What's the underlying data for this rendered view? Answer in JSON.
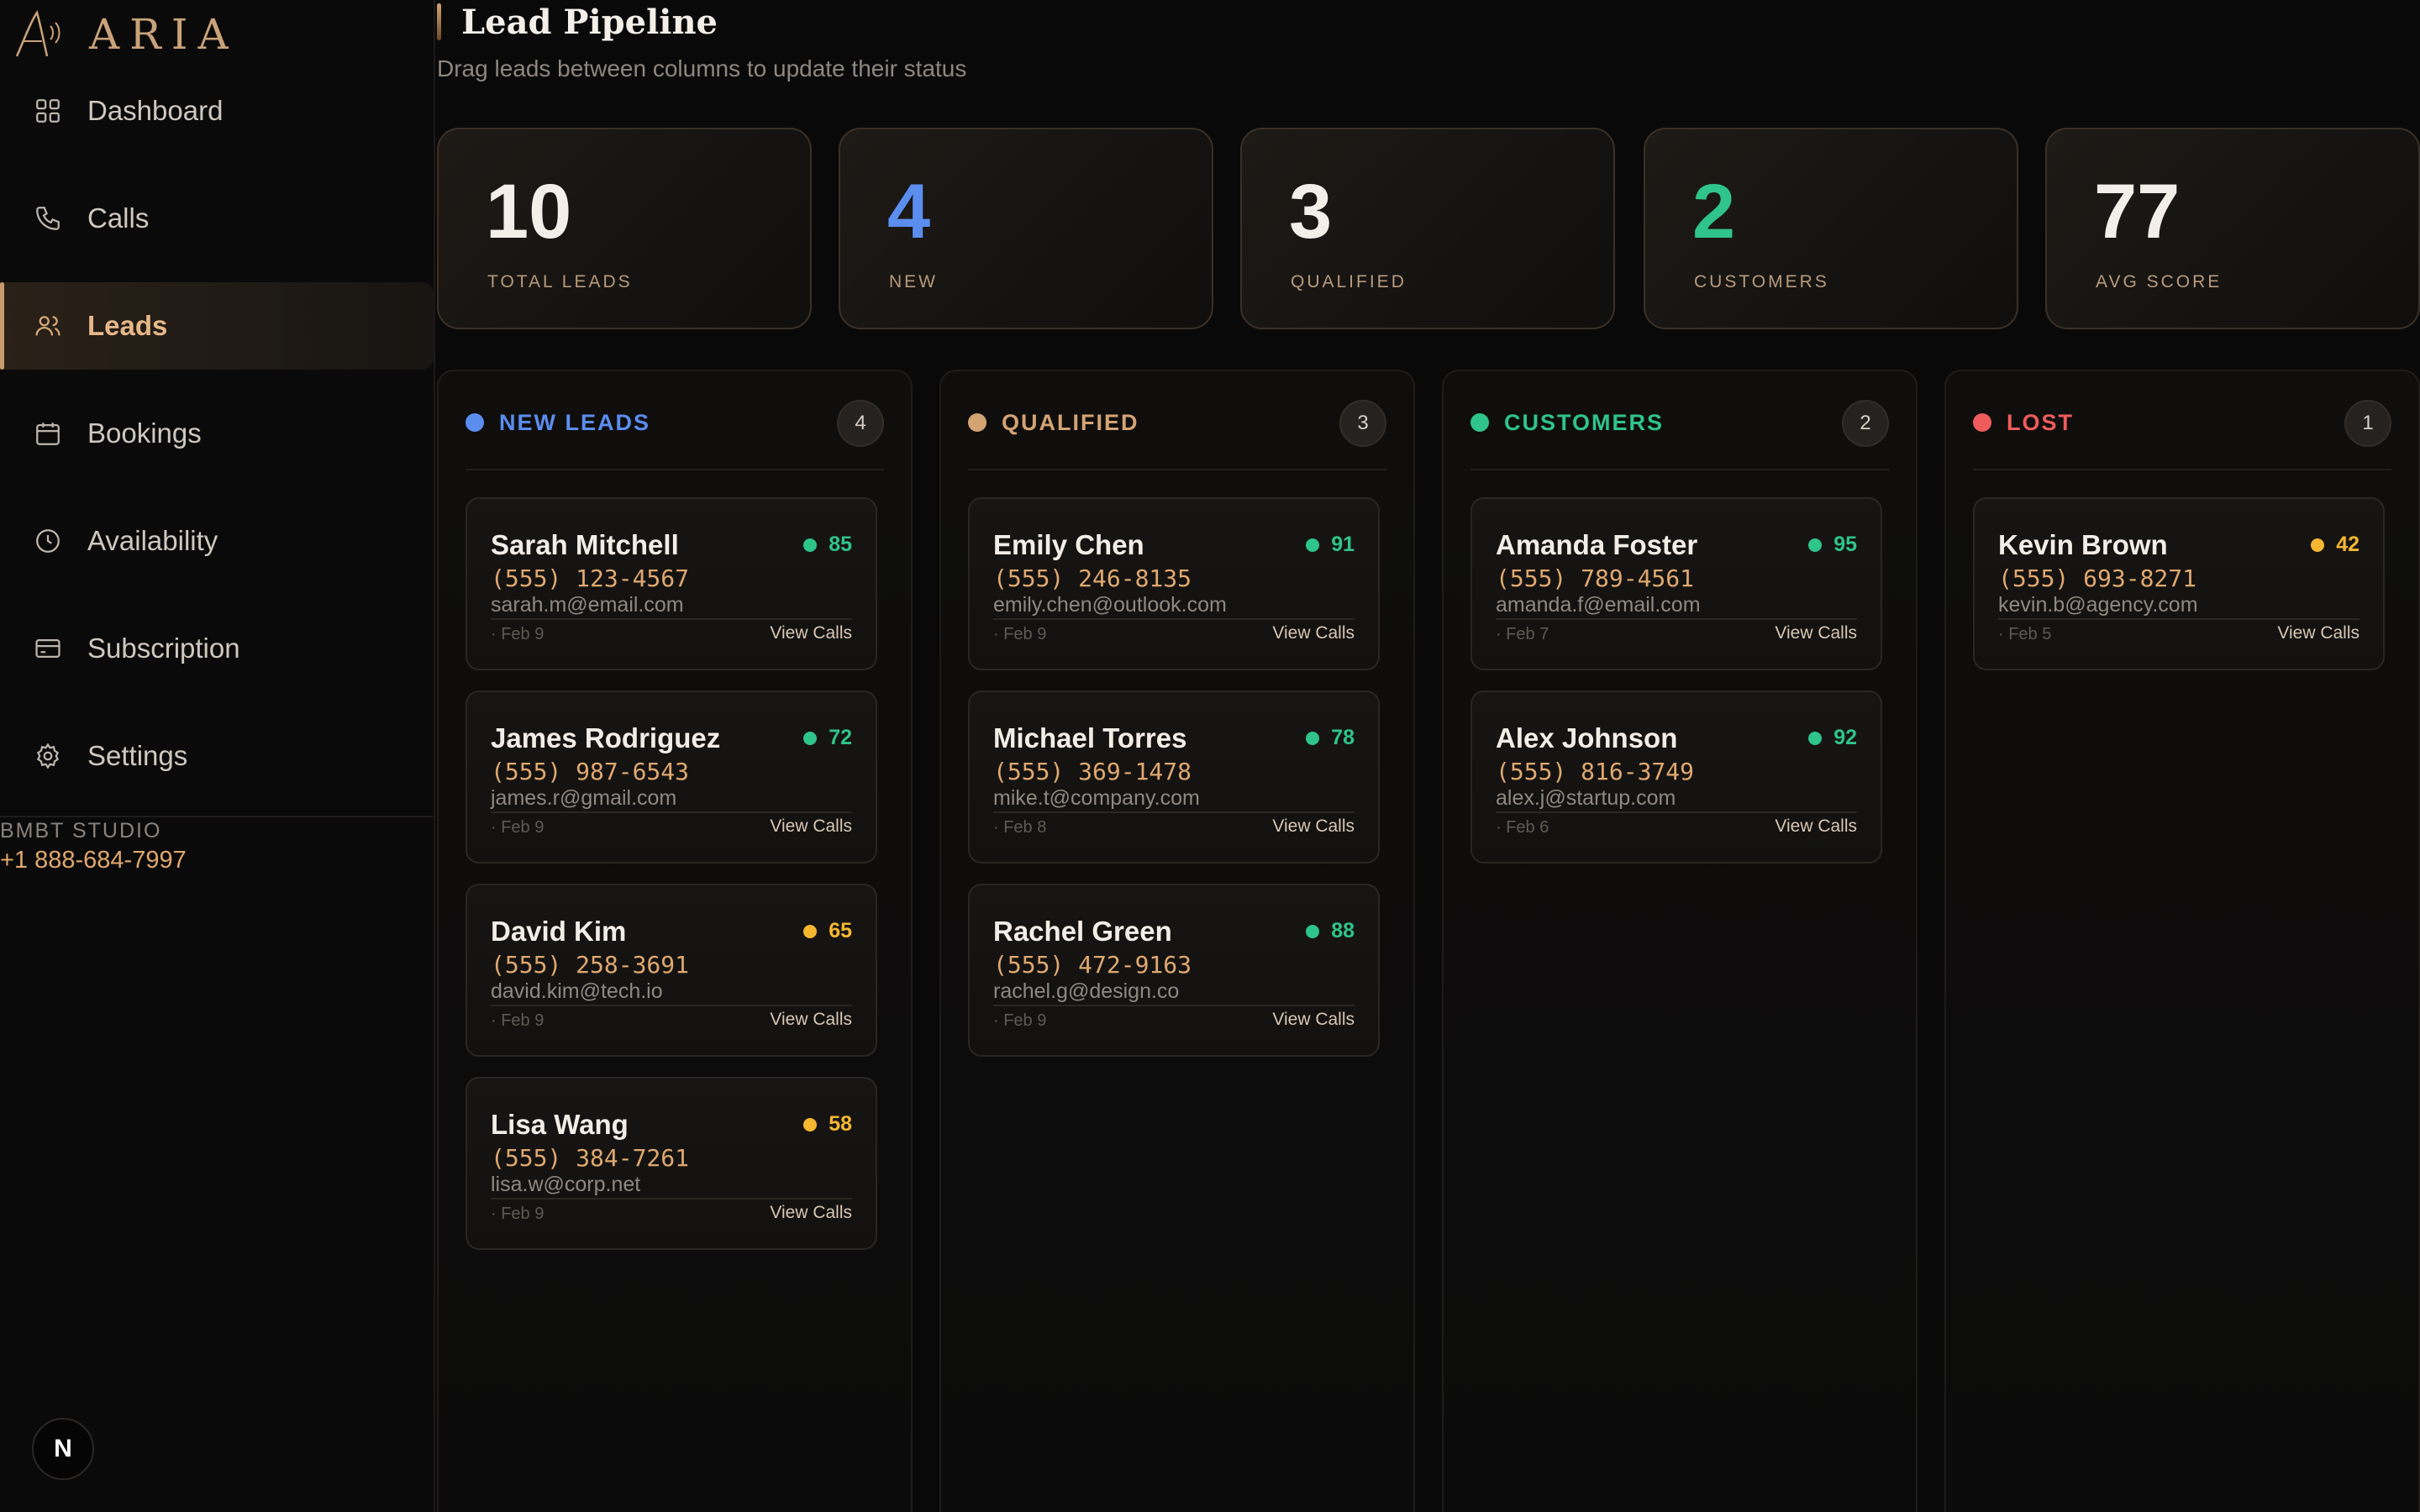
{
  "brand": {
    "name": "ARIA"
  },
  "sidebar": {
    "items": [
      {
        "label": "Dashboard",
        "icon": "grid-icon",
        "active": false
      },
      {
        "label": "Calls",
        "icon": "phone-icon",
        "active": false
      },
      {
        "label": "Leads",
        "icon": "users-icon",
        "active": true
      },
      {
        "label": "Bookings",
        "icon": "calendar-icon",
        "active": false
      },
      {
        "label": "Availability",
        "icon": "clock-icon",
        "active": false
      },
      {
        "label": "Subscription",
        "icon": "credit-card-icon",
        "active": false
      },
      {
        "label": "Settings",
        "icon": "gear-icon",
        "active": false
      }
    ],
    "studio_name": "BMBT STUDIO",
    "studio_phone": "+1 888-684-7997",
    "badge": "N"
  },
  "header": {
    "title": "Lead Pipeline",
    "subtitle": "Drag leads between columns to update their status"
  },
  "stats": [
    {
      "value": "10",
      "label": "TOTAL LEADS",
      "color": "#f3eee8"
    },
    {
      "value": "4",
      "label": "NEW",
      "color": "#5b8def"
    },
    {
      "value": "3",
      "label": "QUALIFIED",
      "color": "#f3eee8"
    },
    {
      "value": "2",
      "label": "CUSTOMERS",
      "color": "#2fc48a"
    },
    {
      "value": "77",
      "label": "AVG SCORE",
      "color": "#f3eee8"
    }
  ],
  "columns": [
    {
      "title": "NEW LEADS",
      "count": "4",
      "color": "#5b8def",
      "cards": [
        {
          "name": "Sarah Mitchell",
          "score": "85",
          "score_color": "#2fc48a",
          "phone": "(555) 123-4567",
          "email": "sarah.m@email.com",
          "date": "· Feb 9",
          "link": "View Calls"
        },
        {
          "name": "James Rodriguez",
          "score": "72",
          "score_color": "#2fc48a",
          "phone": "(555) 987-6543",
          "email": "james.r@gmail.com",
          "date": "· Feb 9",
          "link": "View Calls"
        },
        {
          "name": "David Kim",
          "score": "65",
          "score_color": "#f5b731",
          "phone": "(555) 258-3691",
          "email": "david.kim@tech.io",
          "date": "· Feb 9",
          "link": "View Calls"
        },
        {
          "name": "Lisa Wang",
          "score": "58",
          "score_color": "#f5b731",
          "phone": "(555) 384-7261",
          "email": "lisa.w@corp.net",
          "date": "· Feb 9",
          "link": "View Calls"
        }
      ]
    },
    {
      "title": "QUALIFIED",
      "count": "3",
      "color": "#d4a373",
      "cards": [
        {
          "name": "Emily Chen",
          "score": "91",
          "score_color": "#2fc48a",
          "phone": "(555) 246-8135",
          "email": "emily.chen@outlook.com",
          "date": "· Feb 9",
          "link": "View Calls"
        },
        {
          "name": "Michael Torres",
          "score": "78",
          "score_color": "#2fc48a",
          "phone": "(555) 369-1478",
          "email": "mike.t@company.com",
          "date": "· Feb 8",
          "link": "View Calls"
        },
        {
          "name": "Rachel Green",
          "score": "88",
          "score_color": "#2fc48a",
          "phone": "(555) 472-9163",
          "email": "rachel.g@design.co",
          "date": "· Feb 9",
          "link": "View Calls"
        }
      ]
    },
    {
      "title": "CUSTOMERS",
      "count": "2",
      "color": "#2fc48a",
      "cards": [
        {
          "name": "Amanda Foster",
          "score": "95",
          "score_color": "#2fc48a",
          "phone": "(555) 789-4561",
          "email": "amanda.f@email.com",
          "date": "· Feb 7",
          "link": "View Calls"
        },
        {
          "name": "Alex Johnson",
          "score": "92",
          "score_color": "#2fc48a",
          "phone": "(555) 816-3749",
          "email": "alex.j@startup.com",
          "date": "· Feb 6",
          "link": "View Calls"
        }
      ]
    },
    {
      "title": "LOST",
      "count": "1",
      "color": "#ef5b5b",
      "cards": [
        {
          "name": "Kevin Brown",
          "score": "42",
          "score_color": "#f5b731",
          "phone": "(555) 693-8271",
          "email": "kevin.b@agency.com",
          "date": "· Feb 5",
          "link": "View Calls"
        }
      ]
    }
  ]
}
